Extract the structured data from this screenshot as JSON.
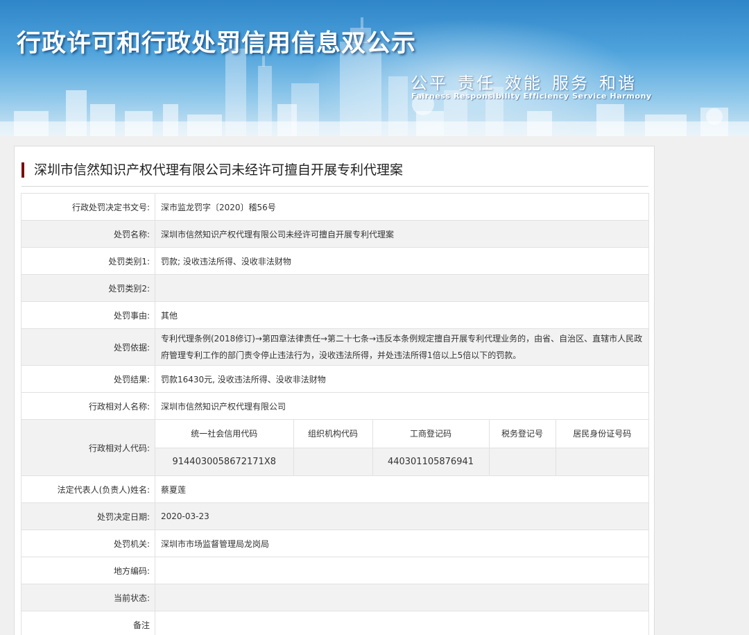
{
  "header": {
    "title": "行政许可和行政处罚信用信息双公示",
    "slogan": [
      "公平",
      "责任",
      "效能",
      "服务",
      "和谐"
    ],
    "slogan_en": "Fairness  Responsibility  Efficiency  Service  Harmony"
  },
  "case": {
    "title": "深圳市信然知识产权代理有限公司未经许可擅自开展专利代理案"
  },
  "rows": [
    {
      "label": "行政处罚决定书文号:",
      "value": "深市监龙罚字〔2020〕稽56号"
    },
    {
      "label": "处罚名称:",
      "value": "深圳市信然知识产权代理有限公司未经许可擅自开展专利代理案"
    },
    {
      "label": "处罚类别1:",
      "value": "罚款; 没收违法所得、没收非法财物"
    },
    {
      "label": "处罚类别2:",
      "value": ""
    },
    {
      "label": "处罚事由:",
      "value": "其他"
    },
    {
      "label": "处罚依据:",
      "value": "专利代理条例(2018修订)→第四章法律责任→第二十七条→违反本条例规定擅自开展专利代理业务的，由省、自治区、直辖市人民政府管理专利工作的部门责令停止违法行为，没收违法所得，并处违法所得1倍以上5倍以下的罚款。"
    },
    {
      "label": "处罚结果:",
      "value": "罚款16430元, 没收违法所得、没收非法财物"
    },
    {
      "label": "行政相对人名称:",
      "value": "深圳市信然知识产权代理有限公司"
    }
  ],
  "codes": {
    "label": "行政相对人代码:",
    "headers": [
      "统一社会信用代码",
      "组织机构代码",
      "工商登记码",
      "税务登记号",
      "居民身份证号码"
    ],
    "values": [
      "9144030058672171X8",
      "",
      "440301105876941",
      "",
      ""
    ]
  },
  "rows2": [
    {
      "label": "法定代表人(负责人)姓名:",
      "value": "蔡夏莲"
    },
    {
      "label": "处罚决定日期:",
      "value": "2020-03-23"
    },
    {
      "label": "处罚机关:",
      "value": "深圳市市场监督管理局龙岗局"
    },
    {
      "label": "地方编码:",
      "value": ""
    },
    {
      "label": "当前状态:",
      "value": ""
    },
    {
      "label": "备注",
      "value": ""
    }
  ],
  "colors": {
    "accent": "#7a0c0c",
    "banner": "#4fa3dc"
  }
}
